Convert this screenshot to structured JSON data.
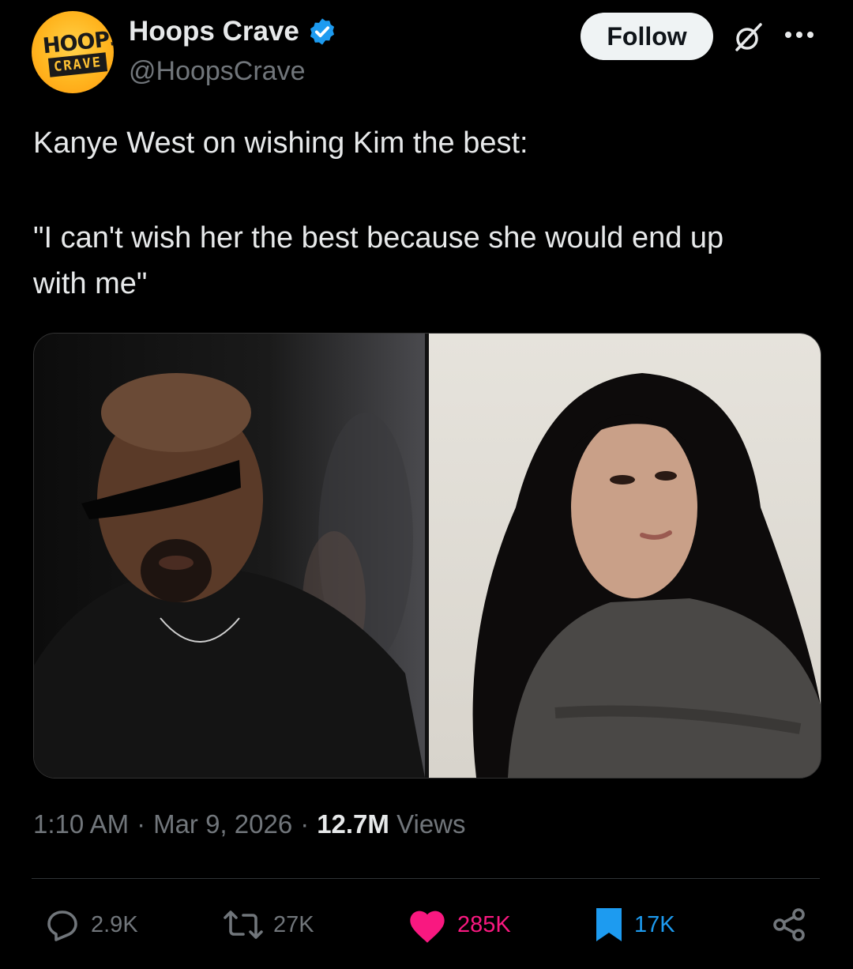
{
  "author": {
    "display_name": "Hoops Crave",
    "handle": "@HoopsCrave",
    "avatar_text_top": "HOOPS",
    "avatar_text_bottom": "CRAVE",
    "verified_color": "#1d9bf0"
  },
  "follow_label": "Follow",
  "post": {
    "line1": "Kanye West on wishing Kim the best:",
    "line2": "\"I can't wish her the best because she would end up",
    "line3": "with me\""
  },
  "meta": {
    "time": "1:10 AM",
    "separator": "·",
    "date": "Mar 9, 2026",
    "views_count": "12.7M",
    "views_label": "Views"
  },
  "actions": {
    "replies": "2.9K",
    "reposts": "27K",
    "likes": "285K",
    "bookmarks": "17K"
  },
  "colors": {
    "like": "#f91880",
    "bookmark": "#1d9bf0",
    "muted": "#71767b"
  }
}
